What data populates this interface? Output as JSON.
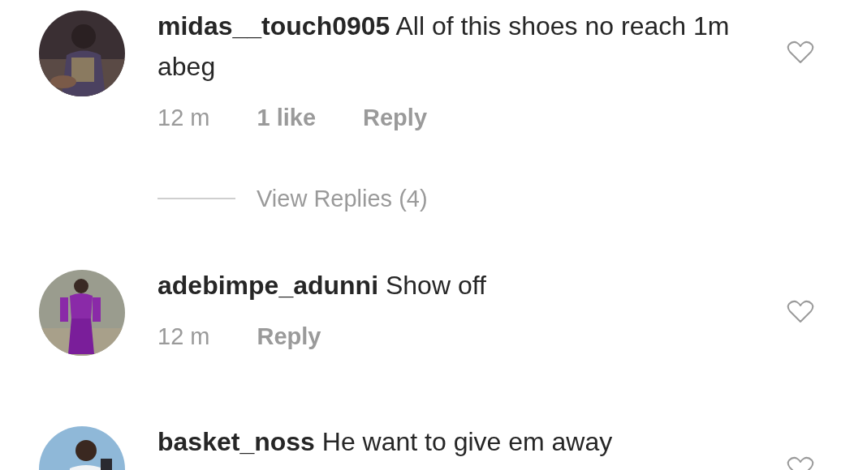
{
  "comments": [
    {
      "username": "midas__touch0905",
      "text": "All of this shoes no reach 1m abeg",
      "liked": false,
      "time": "12 m",
      "likes": "1 like",
      "reply": "Reply",
      "view_replies": "View Replies (4)"
    },
    {
      "username": "adebimpe_adunni",
      "text": "Show off",
      "liked": false,
      "time": "12 m",
      "reply": "Reply"
    },
    {
      "username": "basket_noss",
      "text": "He want to give em away",
      "liked": false
    }
  ]
}
